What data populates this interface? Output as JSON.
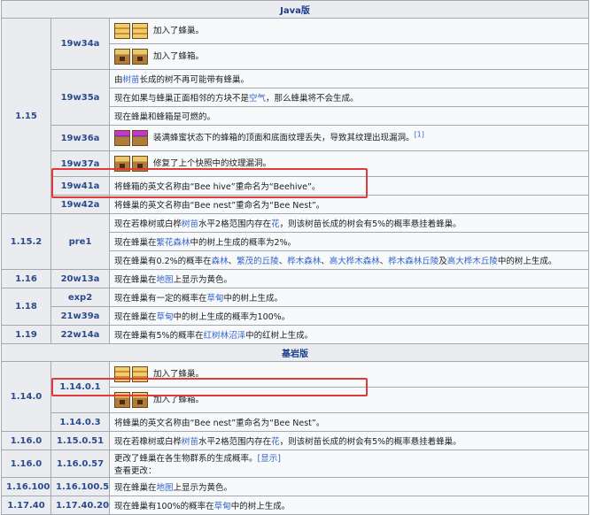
{
  "java": {
    "header": "Java版",
    "groups": [
      {
        "major": "1.15",
        "subs": [
          {
            "ver": "19w34a",
            "rows": [
              {
                "icon": "bee-hive-block",
                "text": "加入了蜂巢。"
              },
              {
                "icon": "bee-nest-block",
                "text": "加入了蜂箱。"
              }
            ]
          },
          {
            "ver": "19w35a",
            "rows": [
              {
                "p1": "由",
                "l1": "树苗",
                "p2": "长成的树不再可能带有蜂巢。"
              },
              {
                "p1": "现在如果与蜂巢正面相邻的方块不是",
                "l1": "空气",
                "p2": "，那么蜂巢将不会生成。"
              },
              {
                "p1": "现在蜂巢和蜂箱是可燃的。"
              }
            ]
          },
          {
            "ver": "19w36a",
            "rows": [
              {
                "icon": "full-bee-nest-block",
                "text": "装满蜂蜜状态下的蜂箱的顶面和底面纹理丢失，导致其纹理出现漏洞。",
                "ref": "[1]"
              }
            ]
          },
          {
            "ver": "19w37a",
            "rows": [
              {
                "icon": "bee-nest-block",
                "text": "修复了上个快照中的纹理漏洞。"
              }
            ]
          },
          {
            "ver": "19w41a",
            "rows": [
              {
                "p1": "将蜂箱的英文名称由“Bee hive”重命名为“Beehive”。"
              }
            ]
          },
          {
            "ver": "19w42a",
            "rows": [
              {
                "p1": "将蜂巢的英文名称由“Bee nest”重命名为“Bee Nest”。"
              }
            ]
          }
        ]
      },
      {
        "major": "1.15.2",
        "subs": [
          {
            "ver": "pre1",
            "rows": [
              {
                "p1": "现在若橡树或白桦",
                "l1": "树苗",
                "p2": "水平2格范围内存在",
                "l2": "花",
                "p3": "，则该树苗长成的树会有5%的概率悬挂着蜂巢。"
              },
              {
                "p1": "现在蜂巢在",
                "l1": "繁花森林",
                "p2": "中的树上生成的概率为2%。"
              },
              {
                "p1": "现在蜂巢有0.2%的概率在",
                "l1": "森林",
                "p2": "、",
                "l2": "繁茂的丘陵",
                "p3": "、",
                "l3": "桦木森林",
                "p4": "、",
                "l4": "高大桦木森林",
                "p5": "、",
                "l5": "桦木森林丘陵",
                "p6": "及",
                "l6": "高大桦木丘陵",
                "p7": "中的树上生成。"
              }
            ]
          }
        ]
      },
      {
        "major": "1.16",
        "subs": [
          {
            "ver": "20w13a",
            "rows": [
              {
                "p1": "现在蜂巢在",
                "l1": "地图",
                "p2": "上显示为黄色。"
              }
            ]
          }
        ]
      },
      {
        "major": "1.18",
        "subs": [
          {
            "ver": "exp2",
            "rows": [
              {
                "p1": "现在蜂巢有一定的概率在",
                "l1": "草甸",
                "p2": "中的树上生成。"
              }
            ]
          },
          {
            "ver": "21w39a",
            "rows": [
              {
                "p1": "现在蜂巢在",
                "l1": "草甸",
                "p2": "中的树上生成的概率为100%。"
              }
            ]
          }
        ]
      },
      {
        "major": "1.19",
        "subs": [
          {
            "ver": "22w14a",
            "rows": [
              {
                "p1": "现在蜂巢有5%的概率在",
                "l1": "红树林沼泽",
                "p2": "中的红树上生成。"
              }
            ]
          }
        ]
      }
    ]
  },
  "bedrock": {
    "header": "基岩版",
    "groups": [
      {
        "major": "1.14.0",
        "subs": [
          {
            "ver": "1.14.0.1",
            "rows": [
              {
                "icon": "bee-hive-block",
                "text": "加入了蜂巢。"
              },
              {
                "icon": "bee-nest-block",
                "text": "加入了蜂箱。"
              }
            ]
          },
          {
            "ver": "1.14.0.3",
            "rows": [
              {
                "p1": "将蜂巢的英文名称由“Bee nest”重命名为“Bee Nest”。"
              }
            ]
          }
        ]
      },
      {
        "major": "1.16.0",
        "subs": [
          {
            "ver": "1.15.0.51",
            "rows": [
              {
                "p1": "现在若橡树或白桦",
                "l1": "树苗",
                "p2": "水平2格范围内存在",
                "l2": "花",
                "p3": "，则该树苗长成的树会有5%的概率悬挂着蜂巢。"
              }
            ]
          }
        ]
      },
      {
        "major": "1.16.0",
        "subs": [
          {
            "ver": "1.16.0.57",
            "rows": [
              {
                "p1": "更改了蜂巢在各生物群系的生成概率。",
                "p2": "查看更改：",
                "l1": "[显示]"
              }
            ]
          }
        ]
      },
      {
        "major": "1.16.100",
        "subs": [
          {
            "ver": "1.16.100.54",
            "rows": [
              {
                "p1": "现在蜂巢在",
                "l1": "地图",
                "p2": "上显示为黄色。"
              }
            ]
          }
        ]
      },
      {
        "major": "1.17.40",
        "subs": [
          {
            "ver": "1.17.40.20",
            "rows": [
              {
                "p1": "现在蜂巢有100%的概率在",
                "l1": "草甸",
                "p2": "中的树上生成。"
              }
            ]
          }
        ]
      }
    ]
  }
}
